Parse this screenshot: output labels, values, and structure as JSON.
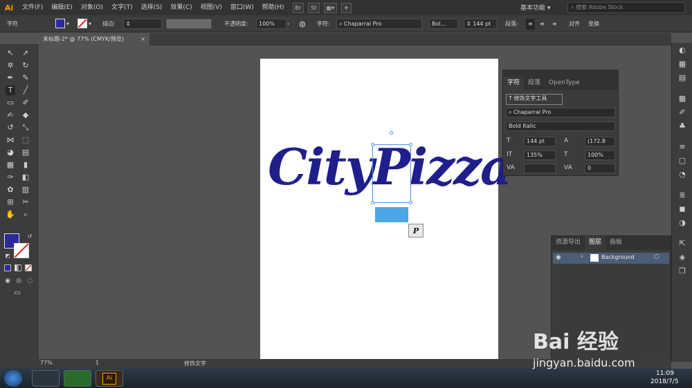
{
  "app": {
    "logo": "Ai"
  },
  "menu": [
    "文件(F)",
    "编辑(E)",
    "对象(O)",
    "文字(T)",
    "选择(S)",
    "效果(C)",
    "视图(V)",
    "窗口(W)",
    "帮助(H)"
  ],
  "menu_buttons": [
    "Br",
    "St"
  ],
  "workspace_label": "基本功能",
  "stock_search_placeholder": "搜索 Adobe Stock",
  "control": {
    "mode_label": "字符",
    "stroke_label": "描边:",
    "opacity_label": "不透明度:",
    "opacity_value": "100%",
    "char_label": "字符:",
    "font_value": "Chaparral Pro",
    "style_value": "Bol...",
    "size_value": "144 pt",
    "para_label": "段落:",
    "align_label": "对齐",
    "transform_label": "变换"
  },
  "doc_tab": {
    "title": "未标题-2* @ 77% (CMYK/预览)",
    "close": "×"
  },
  "canvas": {
    "text": "CityPizza",
    "glyph_tooltip": "P"
  },
  "char_panel": {
    "tabs": [
      "字符",
      "段落",
      "OpenType"
    ],
    "touch_type_button": "修饰文字工具",
    "font_family": "Chaparral Pro",
    "font_style": "Bold Italic",
    "size": "144 pt",
    "leading": "(172.8",
    "vscale": "135%",
    "hscale": "100%",
    "tracking": "0",
    "kerning": ""
  },
  "layers_panel": {
    "tabs": [
      "资源导出",
      "图层",
      "画板"
    ],
    "layer_name": "Background"
  },
  "status": {
    "zoom": "77%",
    "artboard": "1",
    "tool": "修饰文字"
  },
  "taskbar": {
    "time": "11:09",
    "date": "2018/7/5",
    "app": "Ai"
  },
  "watermark": {
    "brand": "Bai 经验",
    "url": "jingyan.baidu.com"
  },
  "colors": {
    "text_fill": "#1f1f8c",
    "fill_swatch": "#2a2a9a",
    "selection": "#4a90e2",
    "highlight": "#4da6e6"
  }
}
